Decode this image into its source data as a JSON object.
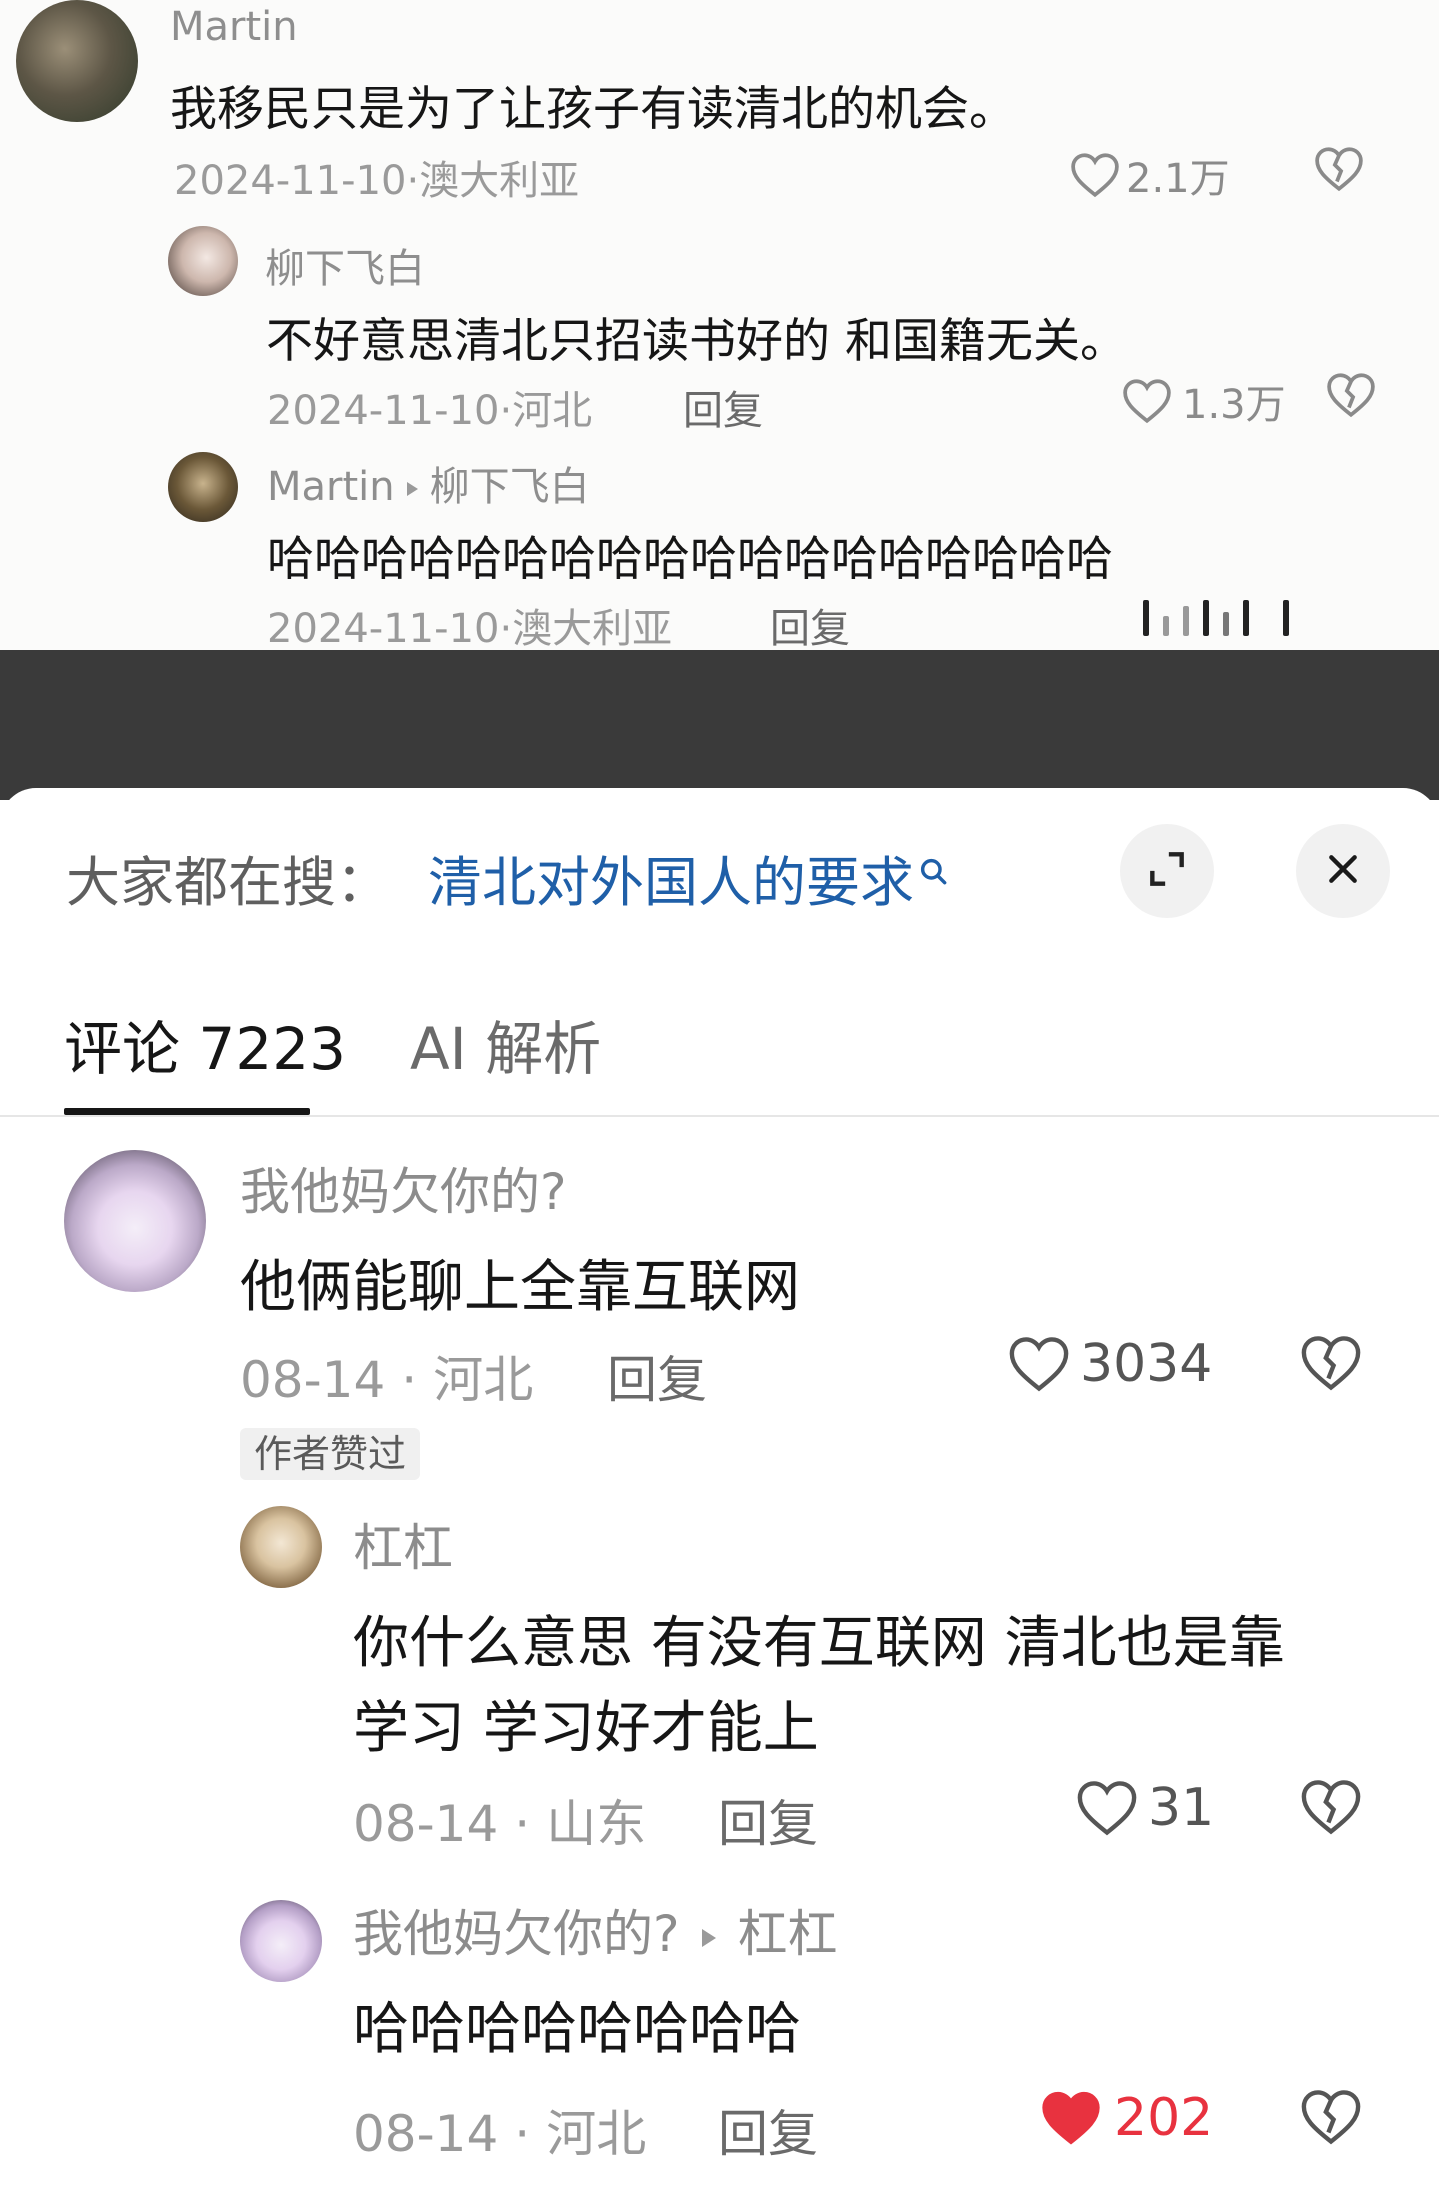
{
  "top_thread": {
    "comment": {
      "username": "Martin",
      "text": "我移民只是为了让孩子有读清北的机会。",
      "date": "2024-11-10",
      "location": "澳大利亚",
      "likes": "2.1万"
    },
    "reply1": {
      "username": "柳下飞白",
      "text": "不好意思清北只招读书好的 和国籍无关。",
      "date": "2024-11-10",
      "location": "河北",
      "reply_label": "回复",
      "likes": "1.3万"
    },
    "reply2": {
      "username": "Martin",
      "reply_to": "柳下飞白",
      "text": "哈哈哈哈哈哈哈哈哈哈哈哈哈哈哈哈哈哈",
      "date": "2024-11-10",
      "location": "澳大利亚",
      "reply_label": "回复"
    },
    "separator": "·"
  },
  "sheet": {
    "search_prefix": "大家都在搜：",
    "search_query": "清北对外国人的要求",
    "tabs": [
      {
        "label": "评论 7223",
        "active": true
      },
      {
        "label": "AI 解析",
        "active": false
      }
    ]
  },
  "comments": [
    {
      "username": "我他妈欠你的?",
      "text": "他俩能聊上全靠互联网",
      "date": "08-14",
      "location": "河北",
      "reply_label": "回复",
      "likes": "3034",
      "badge": "作者赞过",
      "liked": false
    },
    {
      "username": "杠杠",
      "text_line1": "你什么意思 有没有互联网 清北也是靠",
      "text_line2": "学习 学习好才能上",
      "date": "08-14",
      "location": "山东",
      "reply_label": "回复",
      "likes": "31",
      "liked": false
    },
    {
      "username": "我他妈欠你的?",
      "reply_to": "杠杠",
      "text": "哈哈哈哈哈哈哈哈",
      "date": "08-14",
      "location": "河北",
      "reply_label": "回复",
      "likes": "202",
      "liked": true
    }
  ],
  "colors": {
    "link_blue": "#1f5fa8",
    "like_red": "#e8323f",
    "gap_dark": "#3a3a3a"
  },
  "icons": [
    "heart-icon",
    "dislike-icon",
    "search-icon",
    "expand-icon",
    "close-icon",
    "reply-arrow-icon"
  ]
}
